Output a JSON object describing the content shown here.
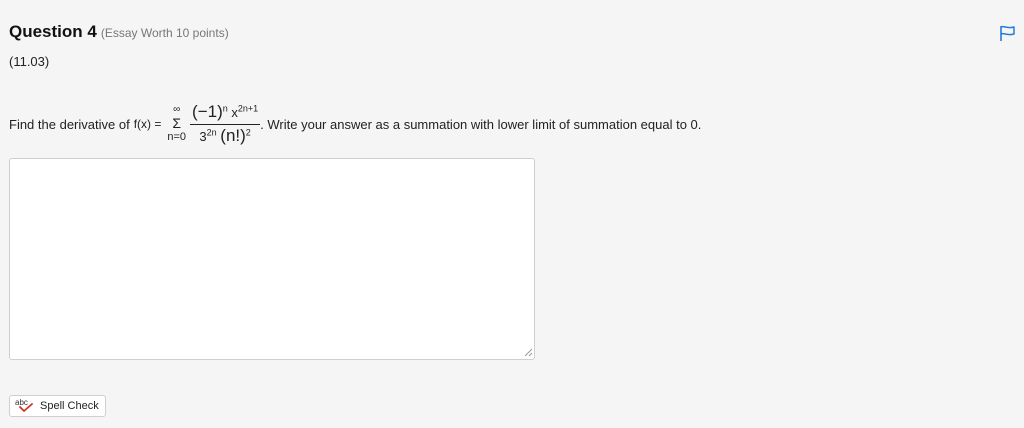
{
  "header": {
    "title": "Question 4",
    "subtitle": "(Essay Worth 10 points)",
    "code": "(11.03)"
  },
  "question": {
    "prefix": "Find the derivative of",
    "function_label": "f(x) =",
    "sum_upper": "∞",
    "sum_symbol": "Σ",
    "sum_lower": "n=0",
    "num_base": "(−1)",
    "num_base_exp": "n",
    "num_var": "x",
    "num_var_exp": "2n+1",
    "den_base": "3",
    "den_base_exp": "2n",
    "den_fact": "(n!)",
    "den_fact_exp": "2",
    "suffix": ". Write your answer as a summation with lower limit of summation equal to 0."
  },
  "answer": {
    "value": "",
    "placeholder": ""
  },
  "spellcheck": {
    "icon_text": "abc",
    "label": "Spell Check"
  },
  "icons": {
    "flag": "flag-icon",
    "spell": "spellcheck-icon",
    "grip": "resize-grip-icon"
  },
  "colors": {
    "flag": "#2a7bd8",
    "spell_check_mark": "#d0332b"
  }
}
